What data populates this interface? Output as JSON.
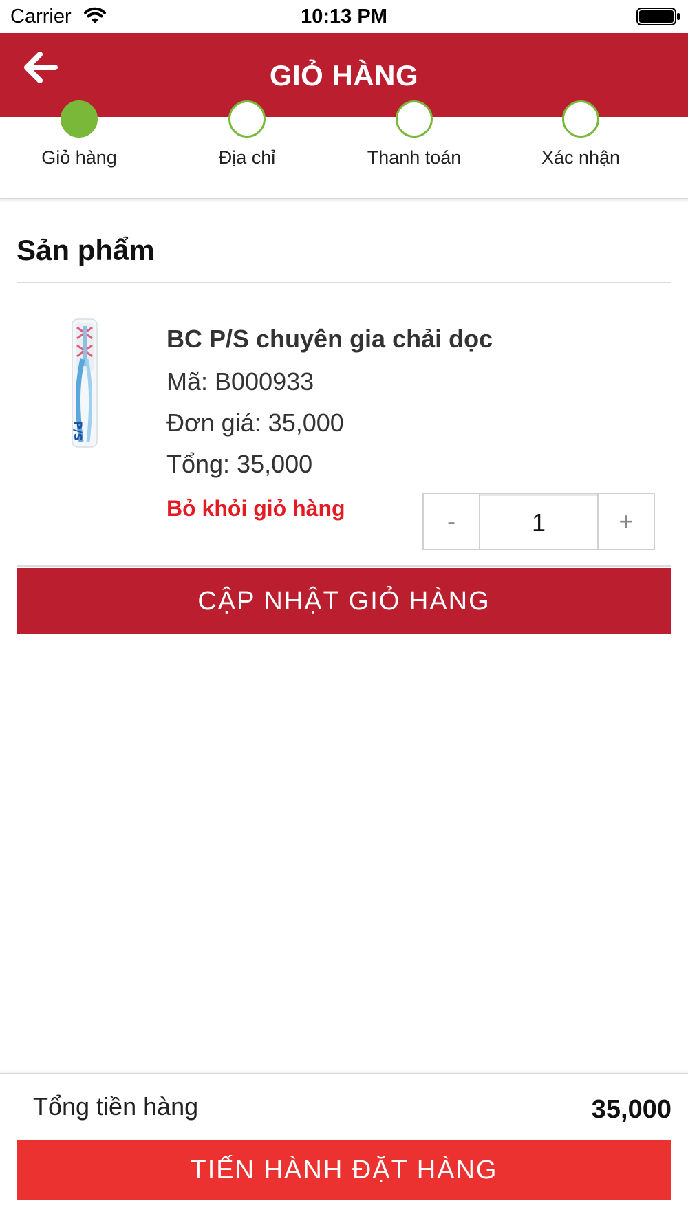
{
  "status_bar": {
    "carrier": "Carrier",
    "time": "10:13 PM"
  },
  "header": {
    "title": "GIỎ HÀNG",
    "back_icon": "arrow-left-icon"
  },
  "stepper": {
    "steps": [
      {
        "label": "Giỏ hàng",
        "active": true
      },
      {
        "label": "Địa chỉ",
        "active": false
      },
      {
        "label": "Thanh toán",
        "active": false
      },
      {
        "label": "Xác nhận",
        "active": false
      }
    ],
    "active_color": "#7ab83a"
  },
  "section": {
    "title": "Sản phẩm"
  },
  "product": {
    "name": "BC P/S chuyên gia chải dọc",
    "code": "Mã: B000933",
    "unit_price": "Đơn giá: 35,000",
    "total": "Tổng: 35,000",
    "remove_label": "Bỏ khỏi giỏ hàng",
    "quantity": "1",
    "minus_label": "-",
    "plus_label": "+"
  },
  "update_button": {
    "label": "CẬP NHẬT GIỎ HÀNG"
  },
  "footer": {
    "total_label": "Tổng tiền hàng",
    "total_amount": "35,000",
    "checkout_label": "TIẾN HÀNH ĐẶT HÀNG"
  },
  "colors": {
    "header_red": "#bb1f2f",
    "checkout_red": "#ec3131",
    "remove_red": "#e41b23",
    "step_green": "#7ab83a"
  }
}
